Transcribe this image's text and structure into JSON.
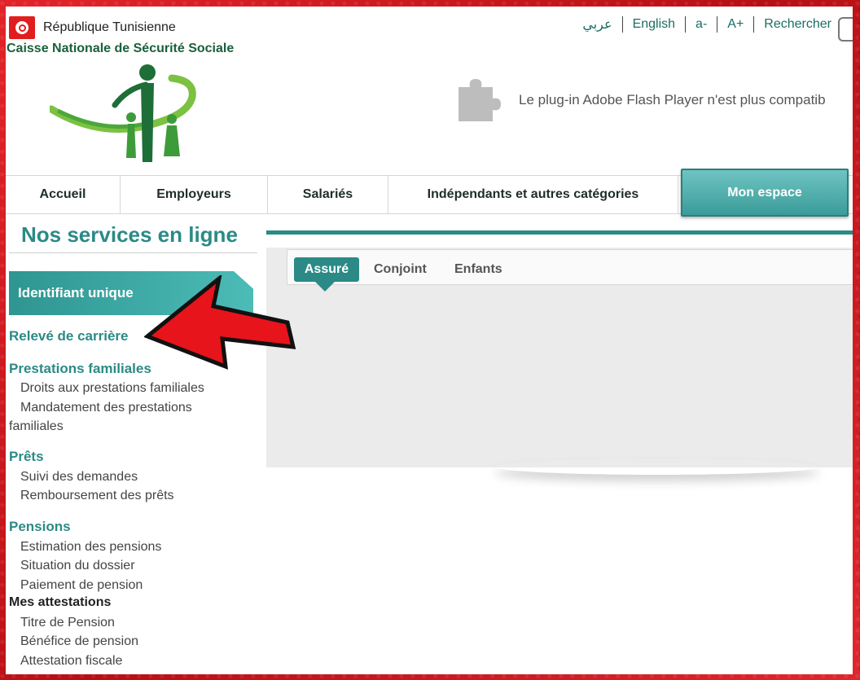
{
  "header": {
    "republic": "République Tunisienne",
    "org_name": "Caisse Nationale de Sécurité Sociale",
    "links": [
      "عربي",
      "English",
      "a-",
      "A+",
      "Rechercher"
    ],
    "plugin_message": "Le plug-in Adobe Flash Player n'est plus compatib"
  },
  "nav": {
    "items": [
      "Accueil",
      "Employeurs",
      "Salariés",
      "Indépendants et autres catégories"
    ],
    "active": "Mon espace"
  },
  "sidebar": {
    "title": "Nos services en ligne",
    "banner": "Identifiant unique",
    "releve": "Relevé de carrière",
    "prestations": {
      "heading": "Prestations familiales",
      "items": [
        "Droits aux prestations familiales",
        "Mandatement des prestations familiales"
      ]
    },
    "prets": {
      "heading": "Prêts",
      "items": [
        "Suivi des demandes",
        "Remboursement des prêts"
      ]
    },
    "pensions": {
      "heading": "Pensions",
      "items": [
        "Estimation des pensions",
        "Situation du dossier",
        "Paiement de pension"
      ]
    },
    "attestations": {
      "heading": "Mes attestations",
      "items": [
        "Titre de Pension",
        "Bénéfice de pension",
        "Attestation fiscale"
      ]
    }
  },
  "tabs": [
    "Assuré",
    "Conjoint",
    "Enfants"
  ],
  "colors": {
    "accent": "#2b8a86",
    "frame": "#d8161c",
    "arrow": "#e8141b"
  }
}
